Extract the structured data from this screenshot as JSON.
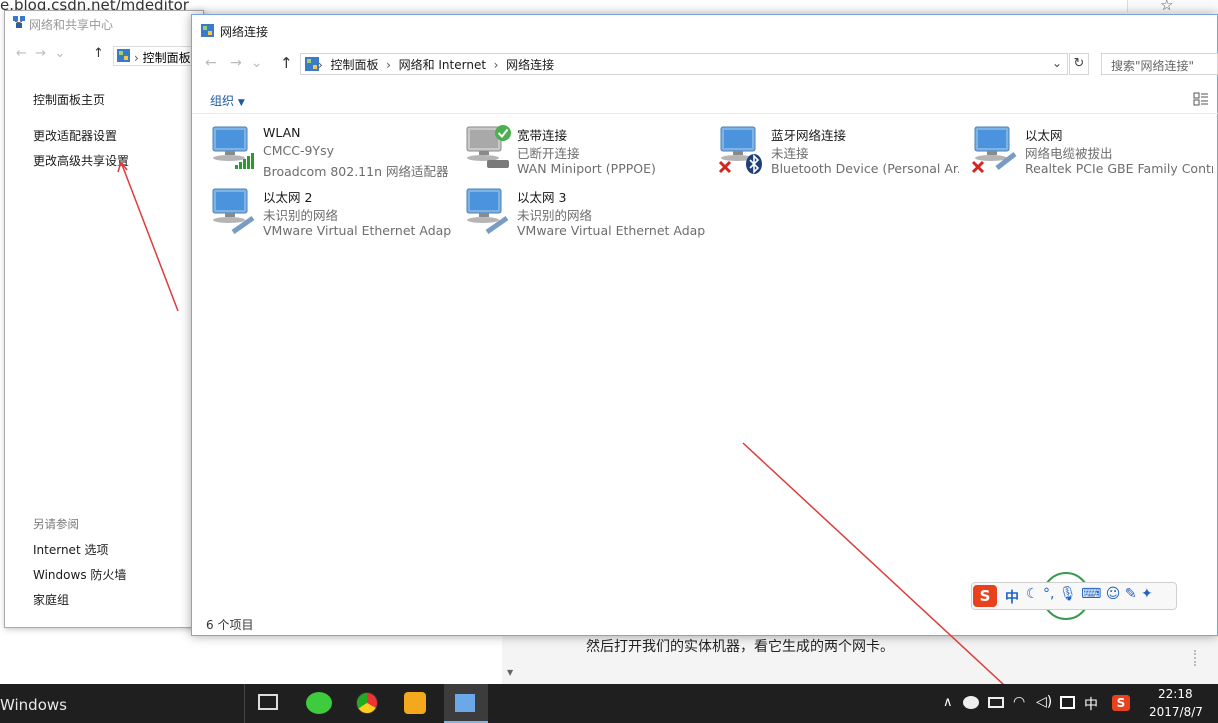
{
  "browser": {
    "url": "e.blog.csdn.net/mdeditor",
    "doc_caption": "然后打开我们的实体机器，看它生成的两个网卡。"
  },
  "back_window": {
    "title": "网络和共享中心",
    "path": "控制面板",
    "links": [
      "控制面板主页",
      "更改适配器设置",
      "更改高级共享设置"
    ],
    "see_also_label": "另请参阅",
    "see_also": [
      "Internet 选项",
      "Windows 防火墙",
      "家庭组"
    ]
  },
  "window": {
    "title": "网络连接",
    "breadcrumb": [
      "控制面板",
      "网络和 Internet",
      "网络连接"
    ],
    "search_placeholder": "搜索\"网络连接\"",
    "organize_label": "组织",
    "status": "6 个项目"
  },
  "adapters": [
    {
      "name": "WLAN",
      "status": "CMCC-9Ysy",
      "device": "Broadcom 802.11n 网络适配器",
      "badge": "signal"
    },
    {
      "name": "宽带连接",
      "status": "已断开连接",
      "device": "WAN Miniport (PPPOE)",
      "badge": "ok"
    },
    {
      "name": "蓝牙网络连接",
      "status": "未连接",
      "device": "Bluetooth Device (Personal Ar...",
      "badge": "error"
    },
    {
      "name": "以太网",
      "status": "网络电缆被拔出",
      "device": "Realtek PCIe GBE Family Contr...",
      "badge": "error"
    },
    {
      "name": "以太网 2",
      "status": "未识别的网络",
      "device": "VMware Virtual Ethernet Adap...",
      "badge": "none"
    },
    {
      "name": "以太网 3",
      "status": "未识别的网络",
      "device": "VMware Virtual Ethernet Adap...",
      "badge": "none"
    }
  ],
  "taskbar": {
    "label": "Windows",
    "time": "22:18",
    "date": "2017/8/7",
    "ime": "中"
  },
  "ime_bar": {
    "lang": "中"
  },
  "colors": {
    "accent": "#1d58a0",
    "taskbar": "#1f1f1f",
    "arrow": "#e03a3a",
    "error": "#d4261f"
  }
}
